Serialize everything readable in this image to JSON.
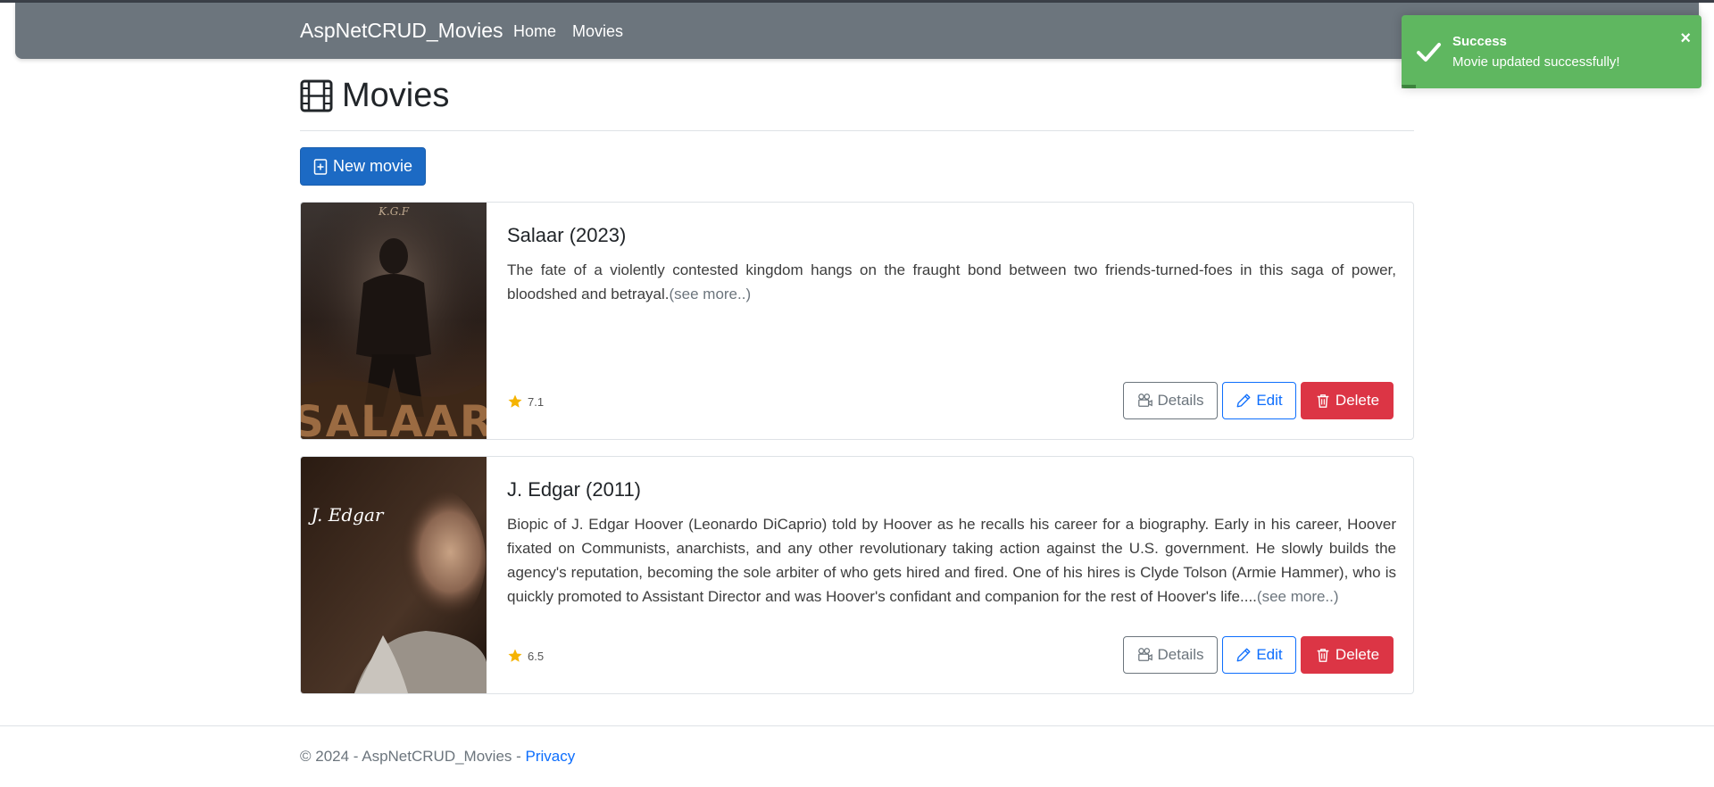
{
  "navbar": {
    "brand": "AspNetCRUD_Movies",
    "links": [
      {
        "label": "Home"
      },
      {
        "label": "Movies"
      }
    ]
  },
  "toast": {
    "title": "Success",
    "message": "Movie updated successfully!",
    "close": "×",
    "color": "#5fb760"
  },
  "page": {
    "title": "Movies",
    "new_button": "New movie"
  },
  "movies": [
    {
      "title": "Salaar (2023)",
      "description": "The fate of a violently contested kingdom hangs on the fraught bond between two friends-turned-foes in this saga of power, bloodshed and betrayal.",
      "see_more": "(see more..)",
      "rating": "7.1",
      "poster_top_text": "K.G.F",
      "poster_bottom_text": "SALAAR"
    },
    {
      "title": "J. Edgar (2011)",
      "description": "Biopic of J. Edgar Hoover (Leonardo DiCaprio) told by Hoover as he recalls his career for a biography. Early in his career, Hoover fixated on Communists, anarchists, and any other revolutionary taking action against the U.S. government. He slowly builds the agency's reputation, becoming the sole arbiter of who gets hired and fired. One of his hires is Clyde Tolson (Armie Hammer), who is quickly promoted to Assistant Director and was Hoover's confidant and companion for the rest of Hoover's life....",
      "see_more": "(see more..)",
      "rating": "6.5",
      "poster_text": "J. Edgar"
    }
  ],
  "actions": {
    "details": "Details",
    "edit": "Edit",
    "delete": "Delete"
  },
  "footer": {
    "copyright": "© 2024 - AspNetCRUD_Movies - ",
    "privacy": "Privacy"
  },
  "colors": {
    "navbar": "#6c757d",
    "primary": "#1c6ac4",
    "danger": "#dc3545",
    "star": "#f5b301"
  }
}
